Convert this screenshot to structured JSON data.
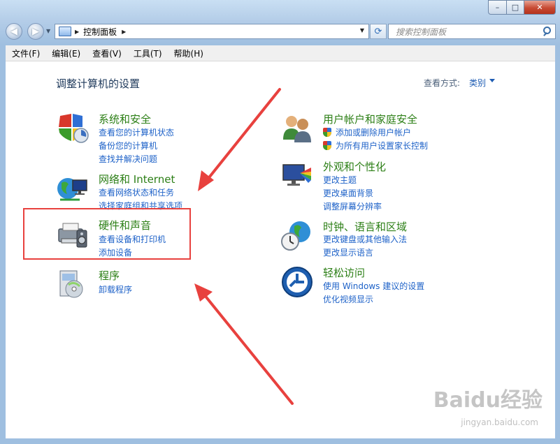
{
  "window": {
    "caption_buttons": {
      "minimize": "–",
      "maximize": "□",
      "close": "✕"
    }
  },
  "nav": {
    "back_icon": "back-arrow-icon",
    "forward_icon": "forward-arrow-icon",
    "address": {
      "icon": "control-panel-icon",
      "path": "控制面板"
    },
    "refresh_icon": "refresh-icon",
    "search": {
      "placeholder": "搜索控制面板",
      "icon": "search-icon"
    }
  },
  "menu": [
    "文件(F)",
    "编辑(E)",
    "查看(V)",
    "工具(T)",
    "帮助(H)"
  ],
  "main": {
    "title": "调整计算机的设置",
    "view_by_label": "查看方式:",
    "view_by_value": "类别"
  },
  "categories_left": [
    {
      "title": "系统和安全",
      "icon": "system-security-icon",
      "links": [
        "查看您的计算机状态",
        "备份您的计算机",
        "查找并解决问题"
      ]
    },
    {
      "title": "网络和 Internet",
      "icon": "network-internet-icon",
      "links": [
        "查看网络状态和任务",
        "选择家庭组和共享选项"
      ]
    },
    {
      "title": "硬件和声音",
      "icon": "hardware-sound-icon",
      "links": [
        "查看设备和打印机",
        "添加设备"
      ]
    },
    {
      "title": "程序",
      "icon": "programs-icon",
      "links": [
        "卸载程序"
      ]
    }
  ],
  "categories_right": [
    {
      "title": "用户帐户和家庭安全",
      "icon": "user-accounts-icon",
      "links": [
        "添加或删除用户帐户",
        "为所有用户设置家长控制"
      ]
    },
    {
      "title": "外观和个性化",
      "icon": "appearance-icon",
      "links": [
        "更改主题",
        "更改桌面背景",
        "调整屏幕分辨率"
      ]
    },
    {
      "title": "时钟、语言和区域",
      "icon": "clock-region-icon",
      "links": [
        "更改键盘或其他输入法",
        "更改显示语言"
      ]
    },
    {
      "title": "轻松访问",
      "icon": "ease-of-access-icon",
      "links": [
        "使用 Windows 建议的设置",
        "优化视频显示"
      ]
    }
  ],
  "annotations": {
    "highlight_color": "#e8413e",
    "arrow_color": "#e8413e"
  },
  "watermark": {
    "logo": "Baidu经验",
    "url": "jingyan.baidu.com"
  },
  "colors": {
    "category_title": "#2c7f16",
    "link": "#1e62c8",
    "title": "#1e395b"
  }
}
